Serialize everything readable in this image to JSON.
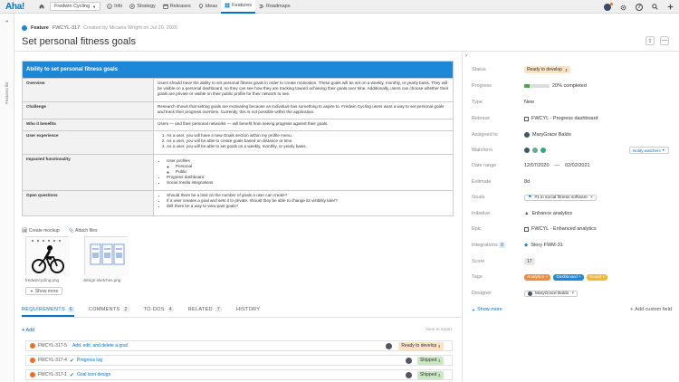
{
  "topbar": {
    "logo": "Aha!",
    "workspace": "Fredwin Cycling",
    "nav": [
      {
        "label": "Info",
        "icon": "info-icon"
      },
      {
        "label": "Strategy",
        "icon": "strategy-icon"
      },
      {
        "label": "Releases",
        "icon": "calendar-icon"
      },
      {
        "label": "Ideas",
        "icon": "lightbulb-icon"
      },
      {
        "label": "Features",
        "icon": "grid-icon",
        "active": true
      },
      {
        "label": "Roadmaps",
        "icon": "roadmap-icon"
      }
    ]
  },
  "rail": {
    "label": "Features list"
  },
  "header": {
    "type": "Feature",
    "ref": "FWCYL-317",
    "meta": "Created by Micaela Wright on Jul 20, 2020",
    "title": "Set personal fitness goals"
  },
  "doc": {
    "heading": "Ability to set personal fitness goals",
    "rows": [
      {
        "k": "Overview",
        "v": "Users should have the ability to set personal fitness goals in order to create motivation. These goals will be set on a weekly, monthly, or yearly basis. They will be visible on a personal dashboard, so they can see how they are tracking toward achieving their goals over time. Additionally, users can choose whether their goals are private or visible on their public profile for their network to see."
      },
      {
        "k": "Challenge",
        "v": "Research shows that setting goals are motivating because an individual has something to aspire to. Fredwin Cycling users want a way to set personal goals and track their progress overtime. Currently, this is not possible within the application."
      },
      {
        "k": "Who it benefits",
        "v": "Users — and their personal networks — will benefit from seeing progress against their goals."
      },
      {
        "k": "User experience",
        "items": [
          "As a user, you will have a new Goals section within my profile menu.",
          "As a user, you will be able to create goals based on distance or time.",
          "As a user, you will be able to set goals on a weekly, monthly, or yearly basis."
        ]
      },
      {
        "k": "Impacted functionality",
        "items": [
          "User profiles",
          "Personal",
          "Public",
          "Progress dashboard",
          "Social media integrations"
        ]
      },
      {
        "k": "Open questions",
        "items": [
          "Should there be a limit on the number of goals a user can create?",
          "If a user creates a goal and sets it to private, should they be able to change its visibility later?",
          "Will there be a way to view past goals?"
        ]
      }
    ]
  },
  "attachments": {
    "create_mockup": "Create mockup",
    "attach_files": "Attach files",
    "files": [
      "fredwincycling.png",
      "design-sketches.png"
    ],
    "show_more": "Show more"
  },
  "tabs": [
    {
      "label": "REQUIREMENTS",
      "count": "6",
      "active": true
    },
    {
      "label": "COMMENTS",
      "count": "2"
    },
    {
      "label": "TO-DOS",
      "count": "4"
    },
    {
      "label": "RELATED",
      "count": "7"
    },
    {
      "label": "HISTORY",
      "count": ""
    }
  ],
  "requirements": {
    "add": "Add",
    "view_in_report": "View in report",
    "items": [
      {
        "ref": "FWCYL-317-5",
        "name": "Add, edit, and delete a goal",
        "status": "Ready to develop",
        "status_color": "#fbe3c4",
        "done": false
      },
      {
        "ref": "FWCYL-317-4",
        "name": "Progress log",
        "status": "Shipped",
        "status_color": "#cde6c5",
        "done": true
      },
      {
        "ref": "FWCYL-317-1",
        "name": "Goal icon design",
        "status": "Shipped",
        "status_color": "#cde6c5",
        "done": true
      }
    ]
  },
  "props": {
    "status": {
      "label": "Status",
      "value": "Ready to develop",
      "color": "#fbe3c4"
    },
    "progress": {
      "label": "Progress",
      "value": "20% completed",
      "percent": 20
    },
    "type": {
      "label": "Type",
      "value": "New"
    },
    "release": {
      "label": "Release",
      "value": "FWCYL - Progress dashboard"
    },
    "assigned": {
      "label": "Assigned to",
      "value": "MaryGrace Baldo"
    },
    "watchers": {
      "label": "Watchers",
      "button": "Notify watchers"
    },
    "date_range": {
      "label": "Date range",
      "start": "12/07/2020",
      "sep": "—",
      "end": "02/02/2021"
    },
    "estimate": {
      "label": "Estimate",
      "value": "8d"
    },
    "goals": {
      "label": "Goals",
      "value": "#1 in social fitness software"
    },
    "initiative": {
      "label": "Initiative",
      "value": "Enhance analytics"
    },
    "epic": {
      "label": "Epic",
      "value": "FWCYL - Enhanced analytics"
    },
    "integrations": {
      "label": "Integrations",
      "count": "0",
      "value": "Story FWM-31"
    },
    "score": {
      "label": "Score",
      "value": "17"
    },
    "tags": {
      "label": "Tags",
      "items": [
        {
          "name": "Analytics",
          "color": "#f28a3c"
        },
        {
          "name": "Dashboard",
          "color": "#1e88d8"
        },
        {
          "name": "Social",
          "color": "#f3b731"
        }
      ]
    },
    "designer": {
      "label": "Designer",
      "value": "MaryGrace Baldo"
    },
    "show_more": "Show more",
    "add_custom": "Add custom field"
  }
}
